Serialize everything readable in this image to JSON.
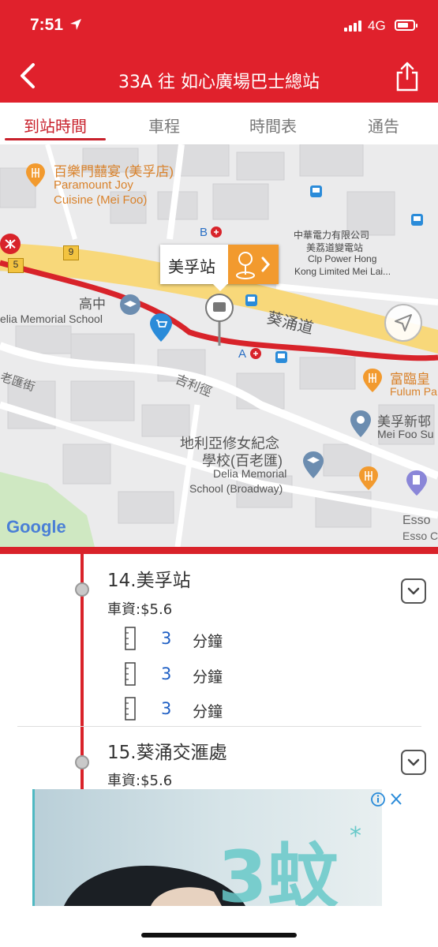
{
  "status_bar": {
    "time": "7:51",
    "network": "4G",
    "battery_level": 0.7
  },
  "header": {
    "title": "33A 往 如心廣場巴士總站"
  },
  "tabs": [
    {
      "label": "到站時間",
      "active": true
    },
    {
      "label": "車程",
      "active": false
    },
    {
      "label": "時間表",
      "active": false
    },
    {
      "label": "通告",
      "active": false
    }
  ],
  "map": {
    "labels": {
      "restaurant_zh": "百樂門囍宴 (美孚店)",
      "restaurant_en1": "Paramount Joy",
      "restaurant_en2": "Cuisine (Mei Foo)",
      "clp_zh1": "中華電力有限公司",
      "clp_zh2": "美荔道變電站",
      "clp_en1": "Clp Power Hong",
      "clp_en2": "Kong Limited Mei Lai...",
      "exit_b": "B",
      "exit_a": "A",
      "route5": "5",
      "route9": "9",
      "school_zh": "高中",
      "school_en": "elia Memorial School",
      "road_kwai_chung": "葵涌道",
      "road_kut_lee": "吉利徑",
      "street_left": "老匯街",
      "fulum_zh": "富臨皇",
      "fulum_en": "Fulum Pa",
      "meifoo_zh": "美孚新邨",
      "meifoo_en": "Mei Foo Su",
      "delia_zh1": "地利亞修女紀念",
      "delia_zh2": "學校(百老匯)",
      "delia_en1": "Delia Memorial",
      "delia_en2": "School (Broadway)",
      "esso1": "Esso",
      "esso2": "Esso C",
      "google": "Google"
    },
    "popup_label": "美孚站"
  },
  "stops": [
    {
      "name": "14.美孚站",
      "fare": "車資:$5.6",
      "etas": [
        {
          "value": "3",
          "unit": "分鐘"
        },
        {
          "value": "3",
          "unit": "分鐘"
        },
        {
          "value": "3",
          "unit": "分鐘"
        }
      ]
    },
    {
      "name": "15.葵涌交滙處",
      "fare": "車資:$5.6"
    }
  ],
  "ad": {
    "headline": "3蚊",
    "star": "*"
  },
  "colors": {
    "brand_red": "#e0212c",
    "eta_blue": "#1f5fc4",
    "accent_orange": "#f29a2e"
  }
}
